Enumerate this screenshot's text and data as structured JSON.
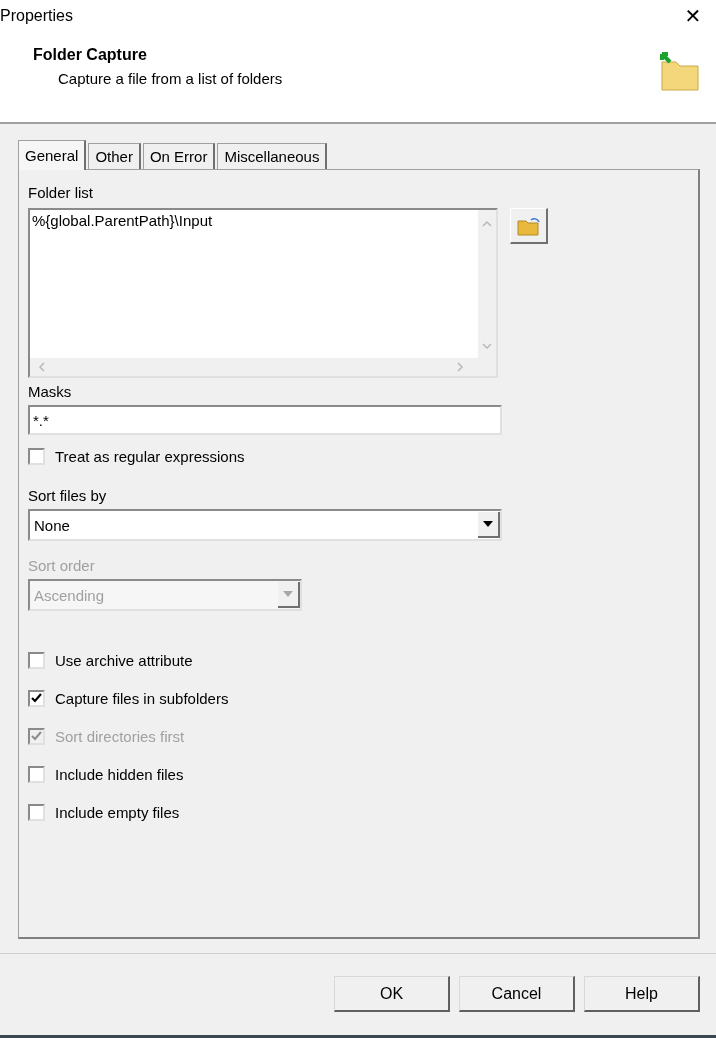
{
  "window": {
    "title": "Properties",
    "close": "✕"
  },
  "header": {
    "title": "Folder Capture",
    "subtitle": "Capture a file from a list of folders"
  },
  "tabs": [
    {
      "label": "General",
      "selected": true
    },
    {
      "label": "Other",
      "selected": false
    },
    {
      "label": "On Error",
      "selected": false
    },
    {
      "label": "Miscellaneous",
      "selected": false
    }
  ],
  "folder_list": {
    "label": "Folder list",
    "value": "%{global.ParentPath}\\Input"
  },
  "masks": {
    "label": "Masks",
    "value": "*.*"
  },
  "regex": {
    "label": "Treat as regular expressions",
    "checked": false,
    "disabled": false
  },
  "sort_files": {
    "label": "Sort files by",
    "value": "None",
    "disabled": false
  },
  "sort_order": {
    "label": "Sort order",
    "value": "Ascending",
    "disabled": true
  },
  "options": [
    {
      "label": "Use archive attribute",
      "checked": false,
      "disabled": false
    },
    {
      "label": "Capture files in subfolders",
      "checked": true,
      "disabled": false
    },
    {
      "label": "Sort directories first",
      "checked": true,
      "disabled": true
    },
    {
      "label": "Include hidden files",
      "checked": false,
      "disabled": false
    },
    {
      "label": "Include empty files",
      "checked": false,
      "disabled": false
    }
  ],
  "buttons": [
    "OK",
    "Cancel",
    "Help"
  ]
}
